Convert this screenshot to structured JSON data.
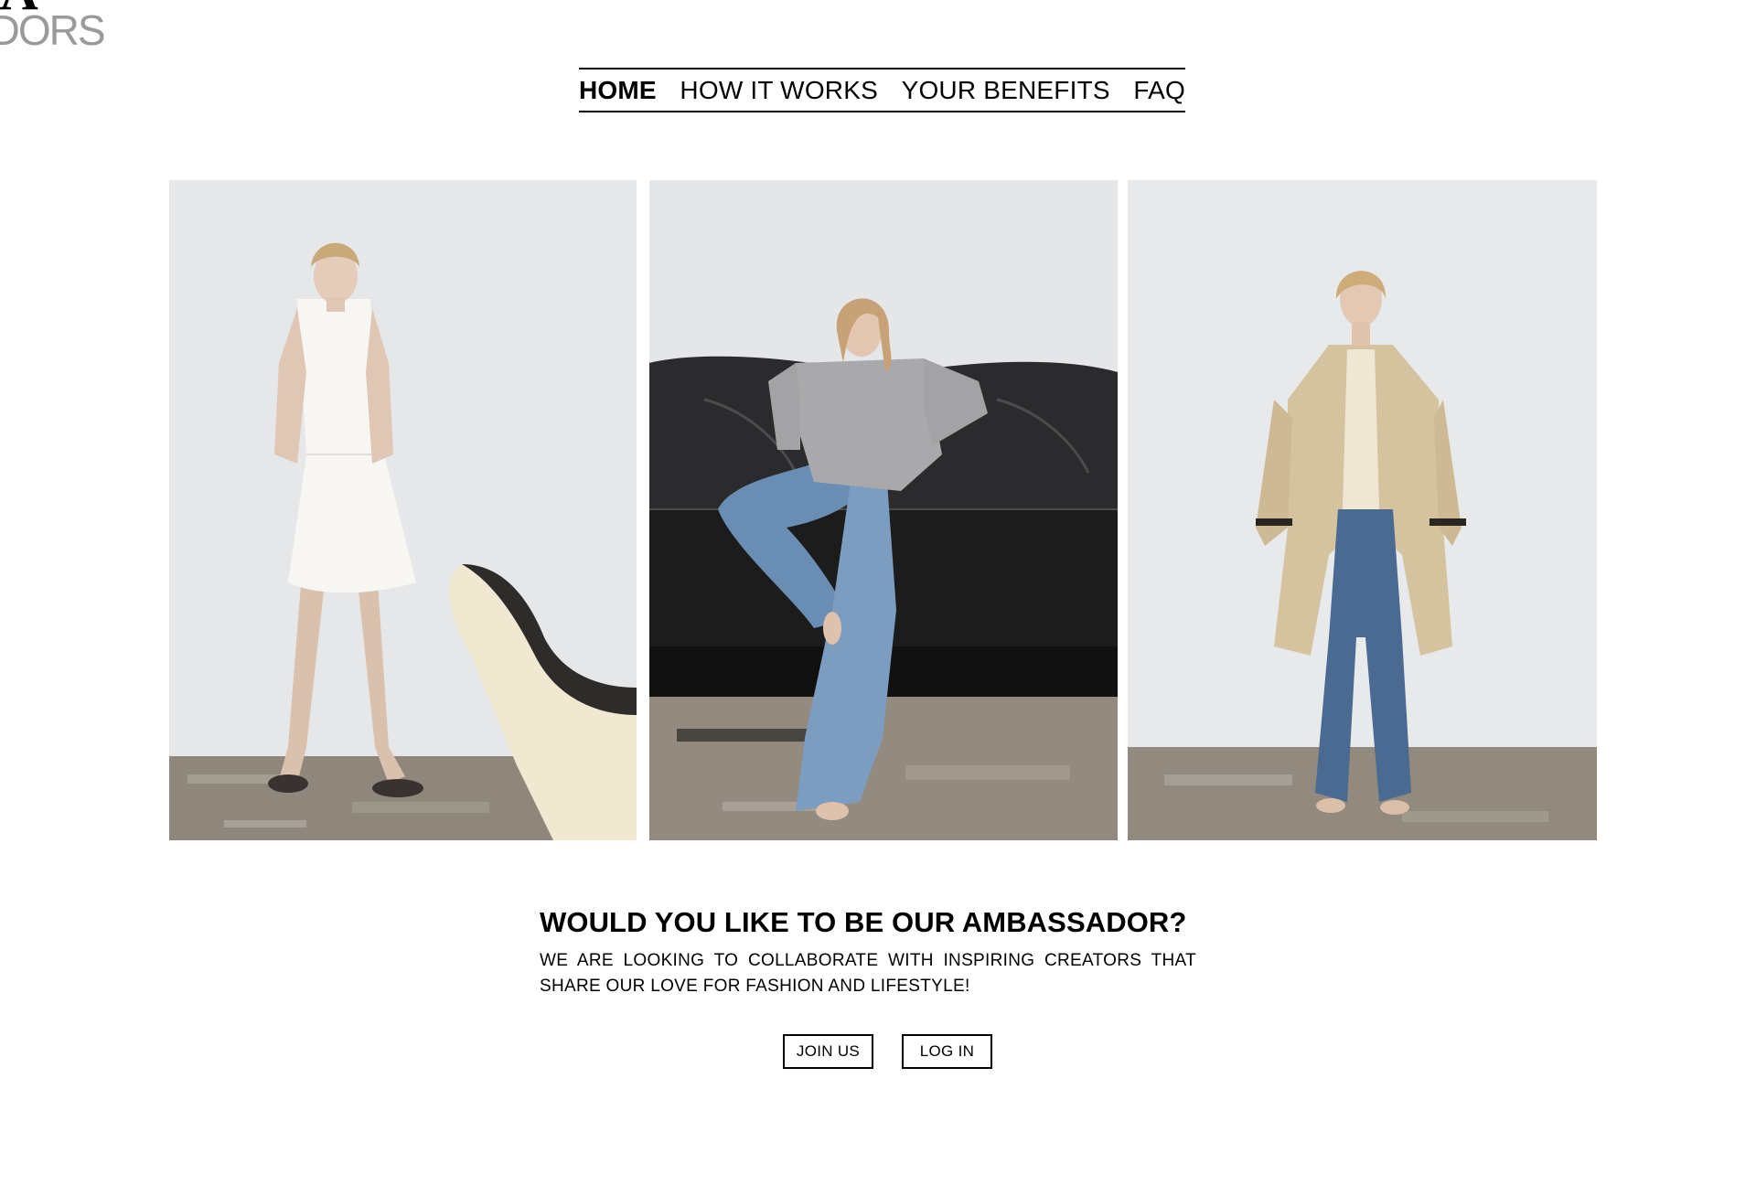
{
  "logo": {
    "mark": "RA",
    "word": "ADORS"
  },
  "nav": {
    "items": [
      {
        "label": "HOME",
        "active": true
      },
      {
        "label": "HOW IT WORKS",
        "active": false
      },
      {
        "label": "YOUR BENEFITS",
        "active": false
      },
      {
        "label": "FAQ",
        "active": false
      }
    ]
  },
  "gallery": {
    "photos": [
      {
        "subject": "model in white sleeveless mini dress beside cream chair"
      },
      {
        "subject": "model in grey cardigan and flared jeans on black leather sofa"
      },
      {
        "subject": "model in beige trench coat and wide-leg jeans"
      }
    ]
  },
  "cta": {
    "title": "WOULD YOU LIKE TO BE OUR AMBASSADOR?",
    "text": "WE ARE LOOKING TO COLLABORATE WITH INSPIRING CREATORS THAT SHARE OUR LOVE FOR FASHION AND LIFESTYLE!",
    "join_label": "JOIN US",
    "login_label": "LOG IN"
  },
  "colors": {
    "background": "#ffffff",
    "text": "#000000",
    "logo_word": "#9a9a9a"
  }
}
